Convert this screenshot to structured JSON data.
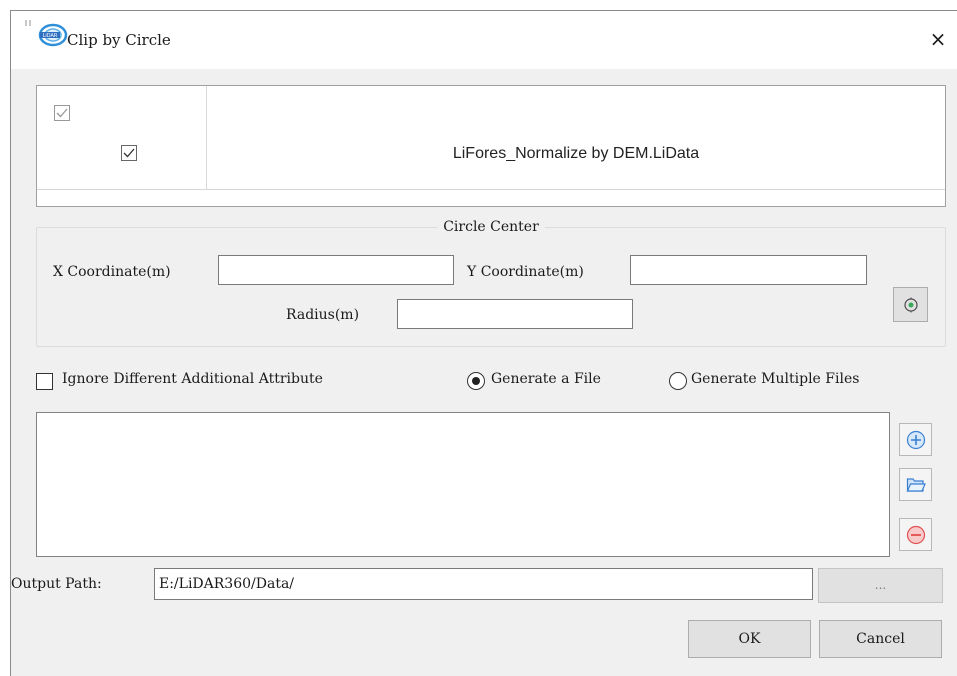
{
  "window": {
    "title": "Clip by Circle",
    "close_glyph": "×",
    "app_icon": "lidar360-logo-icon"
  },
  "file_table": {
    "header_checked": true,
    "rows": [
      {
        "checked": true,
        "filename": "LiFores_Normalize by DEM.LiData"
      }
    ]
  },
  "circle_center": {
    "group_title": "Circle Center",
    "x_label": "X Coordinate(m)",
    "x_value": "",
    "y_label": "Y Coordinate(m)",
    "y_value": "",
    "radius_label": "Radius(m)",
    "radius_value": "",
    "pick_icon": "pick-center-icon"
  },
  "options": {
    "ignore_attr_label": "Ignore Different Additional Attribute",
    "ignore_attr_checked": false,
    "generate_file_label": "Generate a File",
    "generate_multiple_label": "Generate Multiple Files",
    "selected_output_mode": "Generate a File"
  },
  "side_buttons": [
    "add-icon",
    "folder-open-icon",
    "remove-icon"
  ],
  "output": {
    "label": "Output Path:",
    "path": "E:/LiDAR360/Data/",
    "browse_label": "..."
  },
  "buttons": {
    "ok": "OK",
    "cancel": "Cancel"
  },
  "colors": {
    "dialog_bg": "#f0f0f0",
    "accent_blue": "#3b7fd4",
    "remove_red": "#e05050"
  }
}
